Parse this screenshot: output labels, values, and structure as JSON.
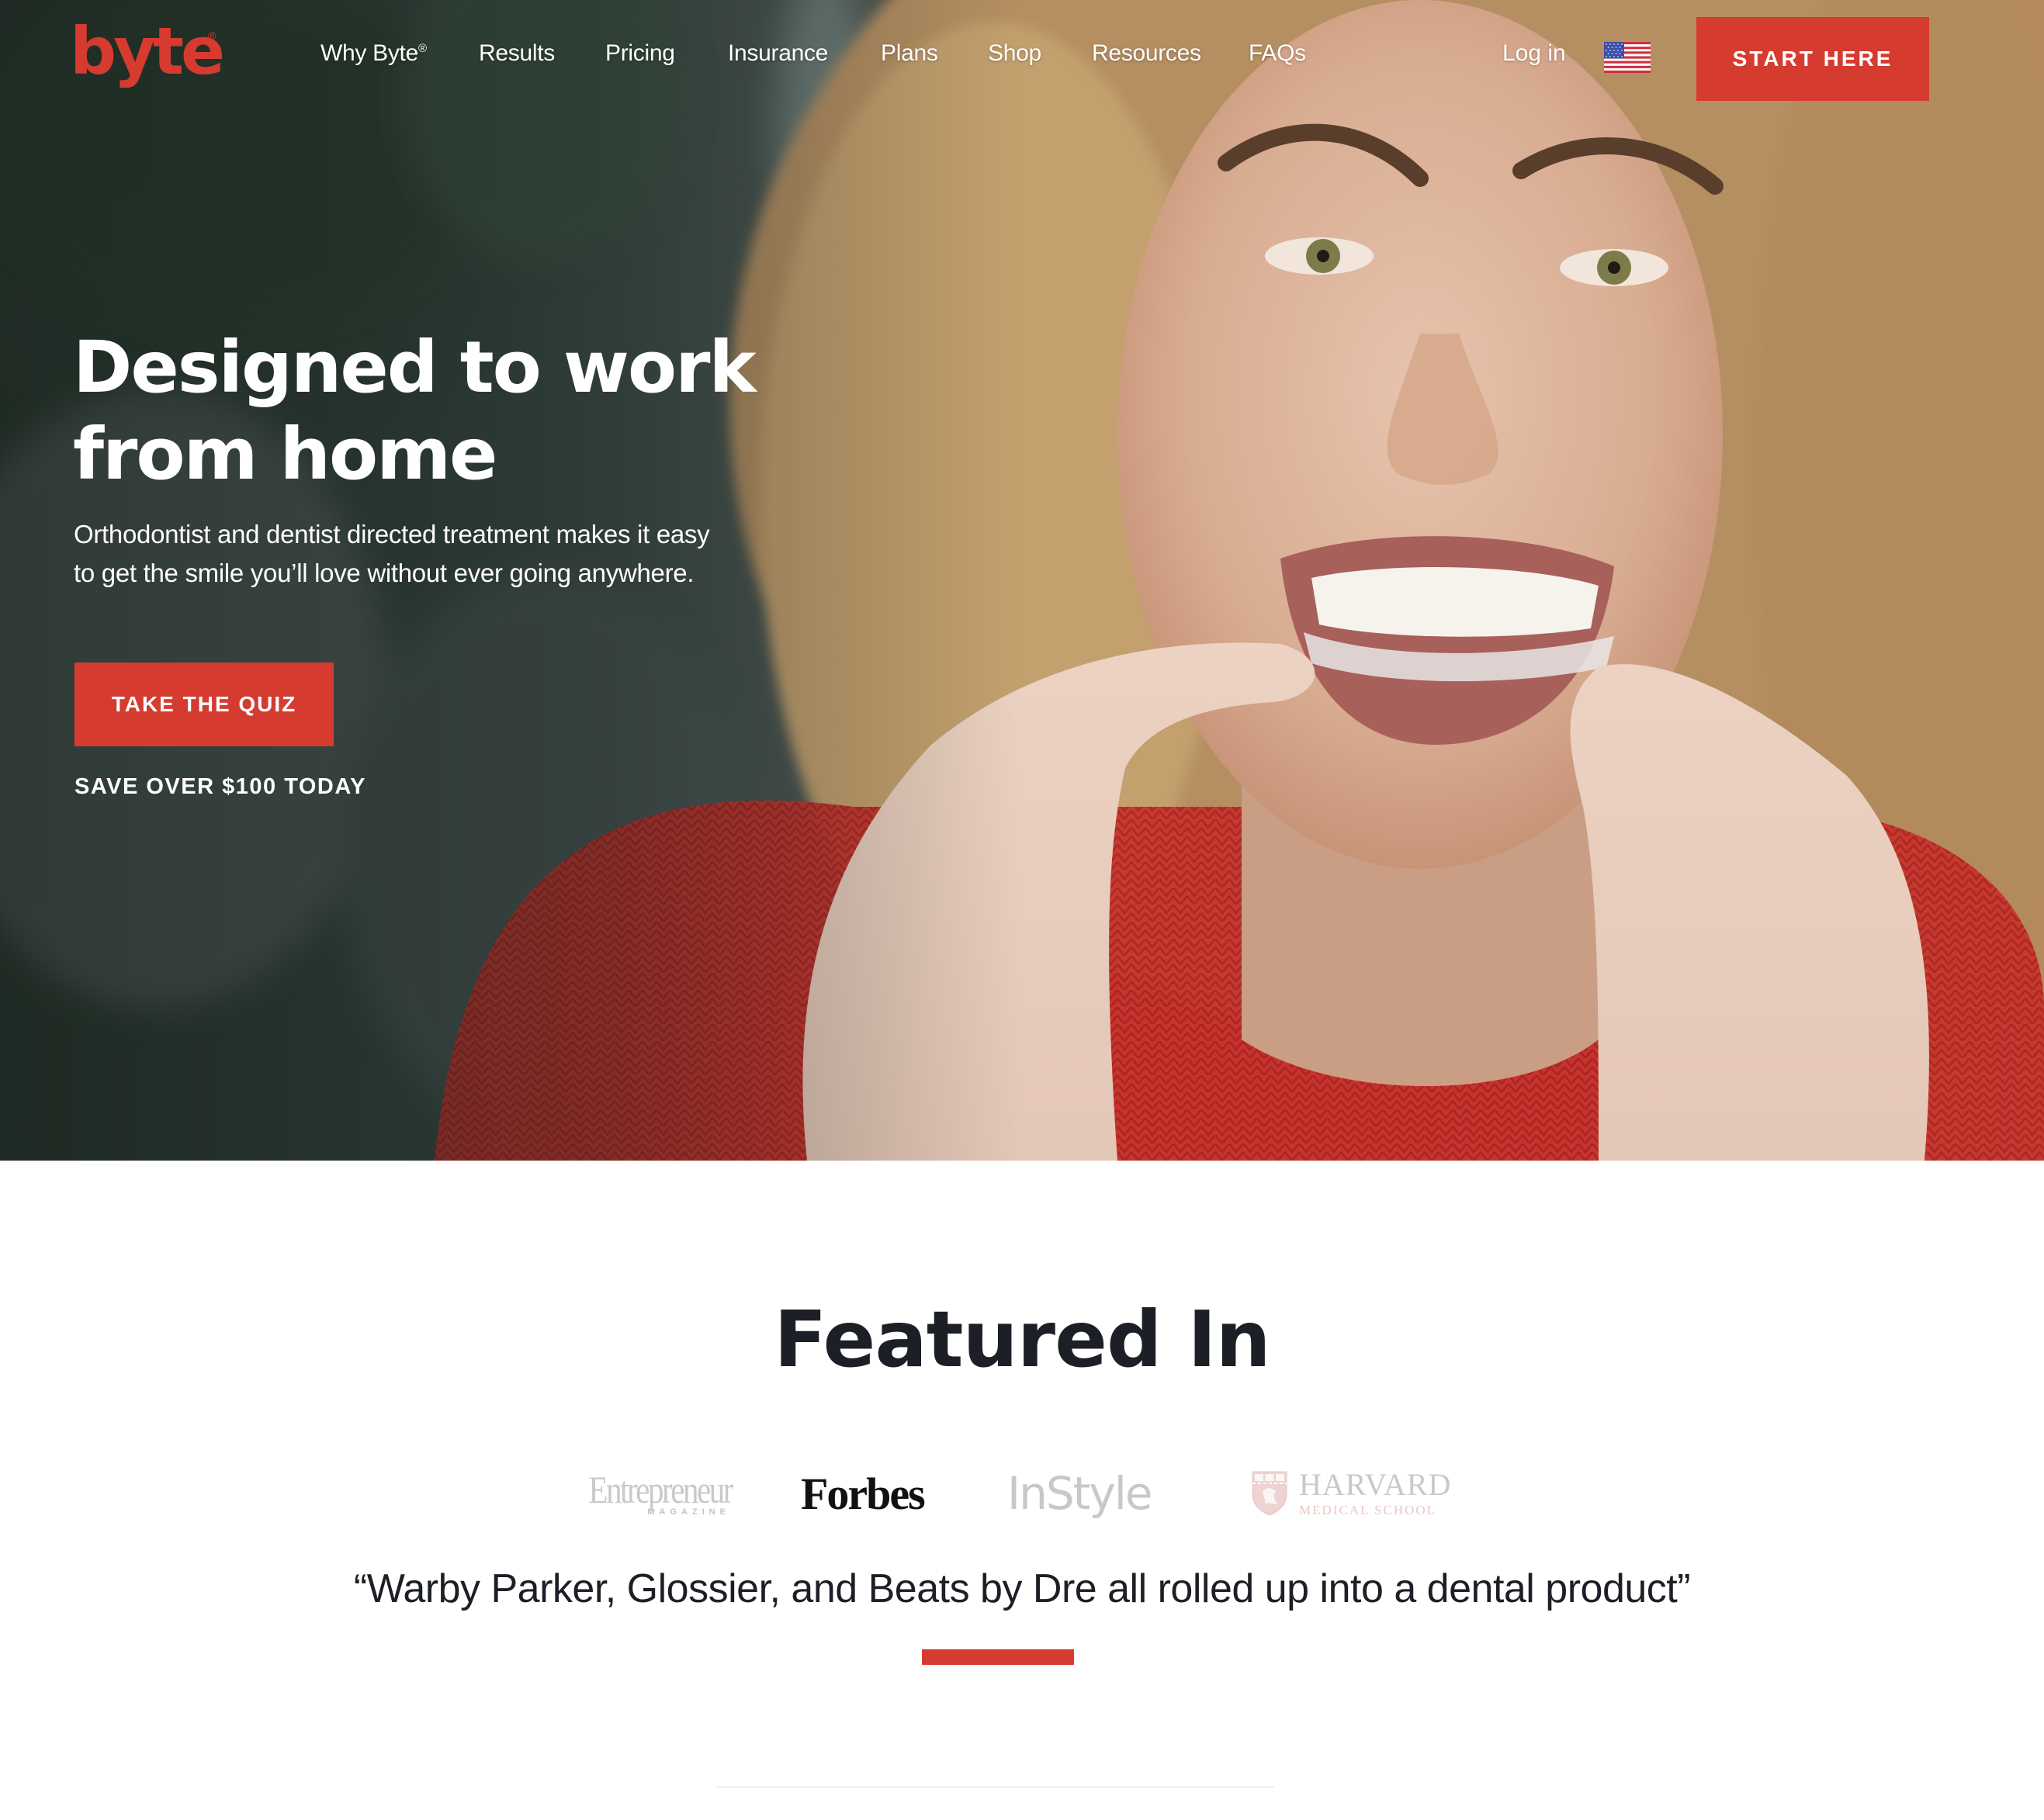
{
  "brand": {
    "logo_text": "byte",
    "logo_registered": "®",
    "accent_color": "#d63b30",
    "dark_text_color": "#1d1f27"
  },
  "nav": {
    "items": [
      {
        "label": "Why Byte",
        "sup": "®"
      },
      {
        "label": "Results"
      },
      {
        "label": "Pricing"
      },
      {
        "label": "Insurance"
      },
      {
        "label": "Plans"
      },
      {
        "label": "Shop"
      },
      {
        "label": "Resources"
      },
      {
        "label": "FAQs"
      }
    ],
    "login_label": "Log in",
    "locale_icon": "us-flag-icon",
    "cta_label": "START HERE"
  },
  "hero": {
    "headline_line1": "Designed to work",
    "headline_line2": "from home",
    "subtext": "Orthodontist and dentist directed treatment makes it easy to get the smile you’ll love without ever going anywhere.",
    "quiz_button_label": "TAKE THE QUIZ",
    "promo_text": "SAVE OVER $100 TODAY",
    "image_description": "Smiling woman with curly blonde hair in red sweater inserting clear aligner"
  },
  "featured": {
    "title": "Featured In",
    "logos": [
      {
        "name": "Entrepreneur",
        "sub": "MAGAZINE"
      },
      {
        "name": "Forbes"
      },
      {
        "name": "InStyle"
      },
      {
        "name": "HARVARD",
        "sub": "MEDICAL SCHOOL"
      }
    ],
    "quote": "“Warby Parker, Glossier, and Beats by Dre all rolled up into a dental product”"
  }
}
